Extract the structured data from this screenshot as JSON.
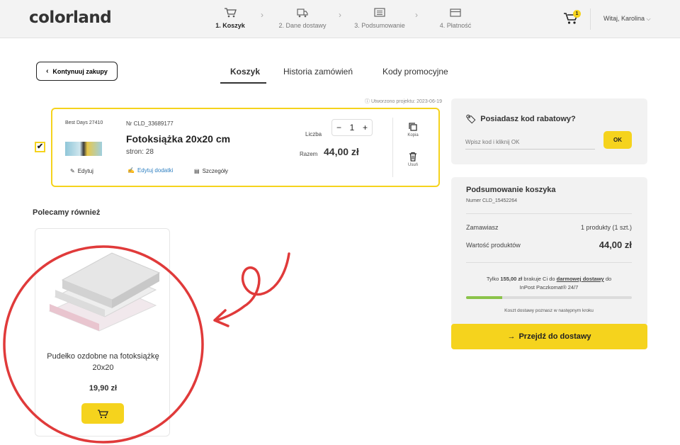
{
  "header": {
    "logo": "colorland",
    "steps": [
      {
        "label": "1. Koszyk",
        "icon": "cart-icon"
      },
      {
        "label": "2. Dane dostawy",
        "icon": "truck-icon"
      },
      {
        "label": "3. Podsumowanie",
        "icon": "list-icon"
      },
      {
        "label": "4. Płatność",
        "icon": "card-icon"
      }
    ],
    "cart_count": "1",
    "user_greeting": "Witaj, Karolina"
  },
  "nav": {
    "back_label": "Kontynuuj zakupy",
    "tabs": [
      "Koszyk",
      "Historia zamówień",
      "Kody promocyjne"
    ],
    "active_tab": "Koszyk"
  },
  "cart": {
    "created_label": "Utworzono projektu: 2023-06-19",
    "item": {
      "promo_tag": "Best Days 27410",
      "nr": "Nr CLD_33689177",
      "name": "Fotoksiążka 20x20 cm",
      "pages": "stron: 28",
      "edit_label": "Edytuj",
      "edit_extras_label": "Edytuj dodatki",
      "details_label": "Szczegóły",
      "qty_label": "Liczba",
      "qty": "1",
      "sum_label": "Razem",
      "price": "44,00 zł",
      "copy_label": "Kopia",
      "delete_label": "Usuń"
    }
  },
  "recommended": {
    "title": "Polecamy również",
    "product": {
      "name": "Pudełko ozdobne na fotoksiążkę 20x20",
      "price": "19,90 zł"
    }
  },
  "promo": {
    "title": "Posiadasz kod rabatowy?",
    "placeholder": "Wpisz kod i kliknij OK",
    "ok_label": "OK"
  },
  "summary": {
    "title": "Podsumowanie koszyka",
    "nr": "Numer CLD_15452264",
    "ordered_label": "Zamawiasz",
    "ordered_value": "1 produkty (1 szt.)",
    "value_label": "Wartość produktów",
    "value": "44,00 zł",
    "ship_text_1": "Tylko ",
    "ship_amount": "155,00 zł",
    "ship_text_2": " brakuje Ci do ",
    "ship_free": "darmowej dostawy",
    "ship_text_3": " do",
    "ship_text_4": "InPost Paczkomat® 24/7",
    "progress_fraction": 0.22,
    "ship_note": "Koszt dostawy poznasz w następnym kroku",
    "proceed_label": "Przejdź do dostawy"
  },
  "colors": {
    "accent": "#f5d31d",
    "annotation": "#e03a3a",
    "progress": "#8bc34a"
  }
}
